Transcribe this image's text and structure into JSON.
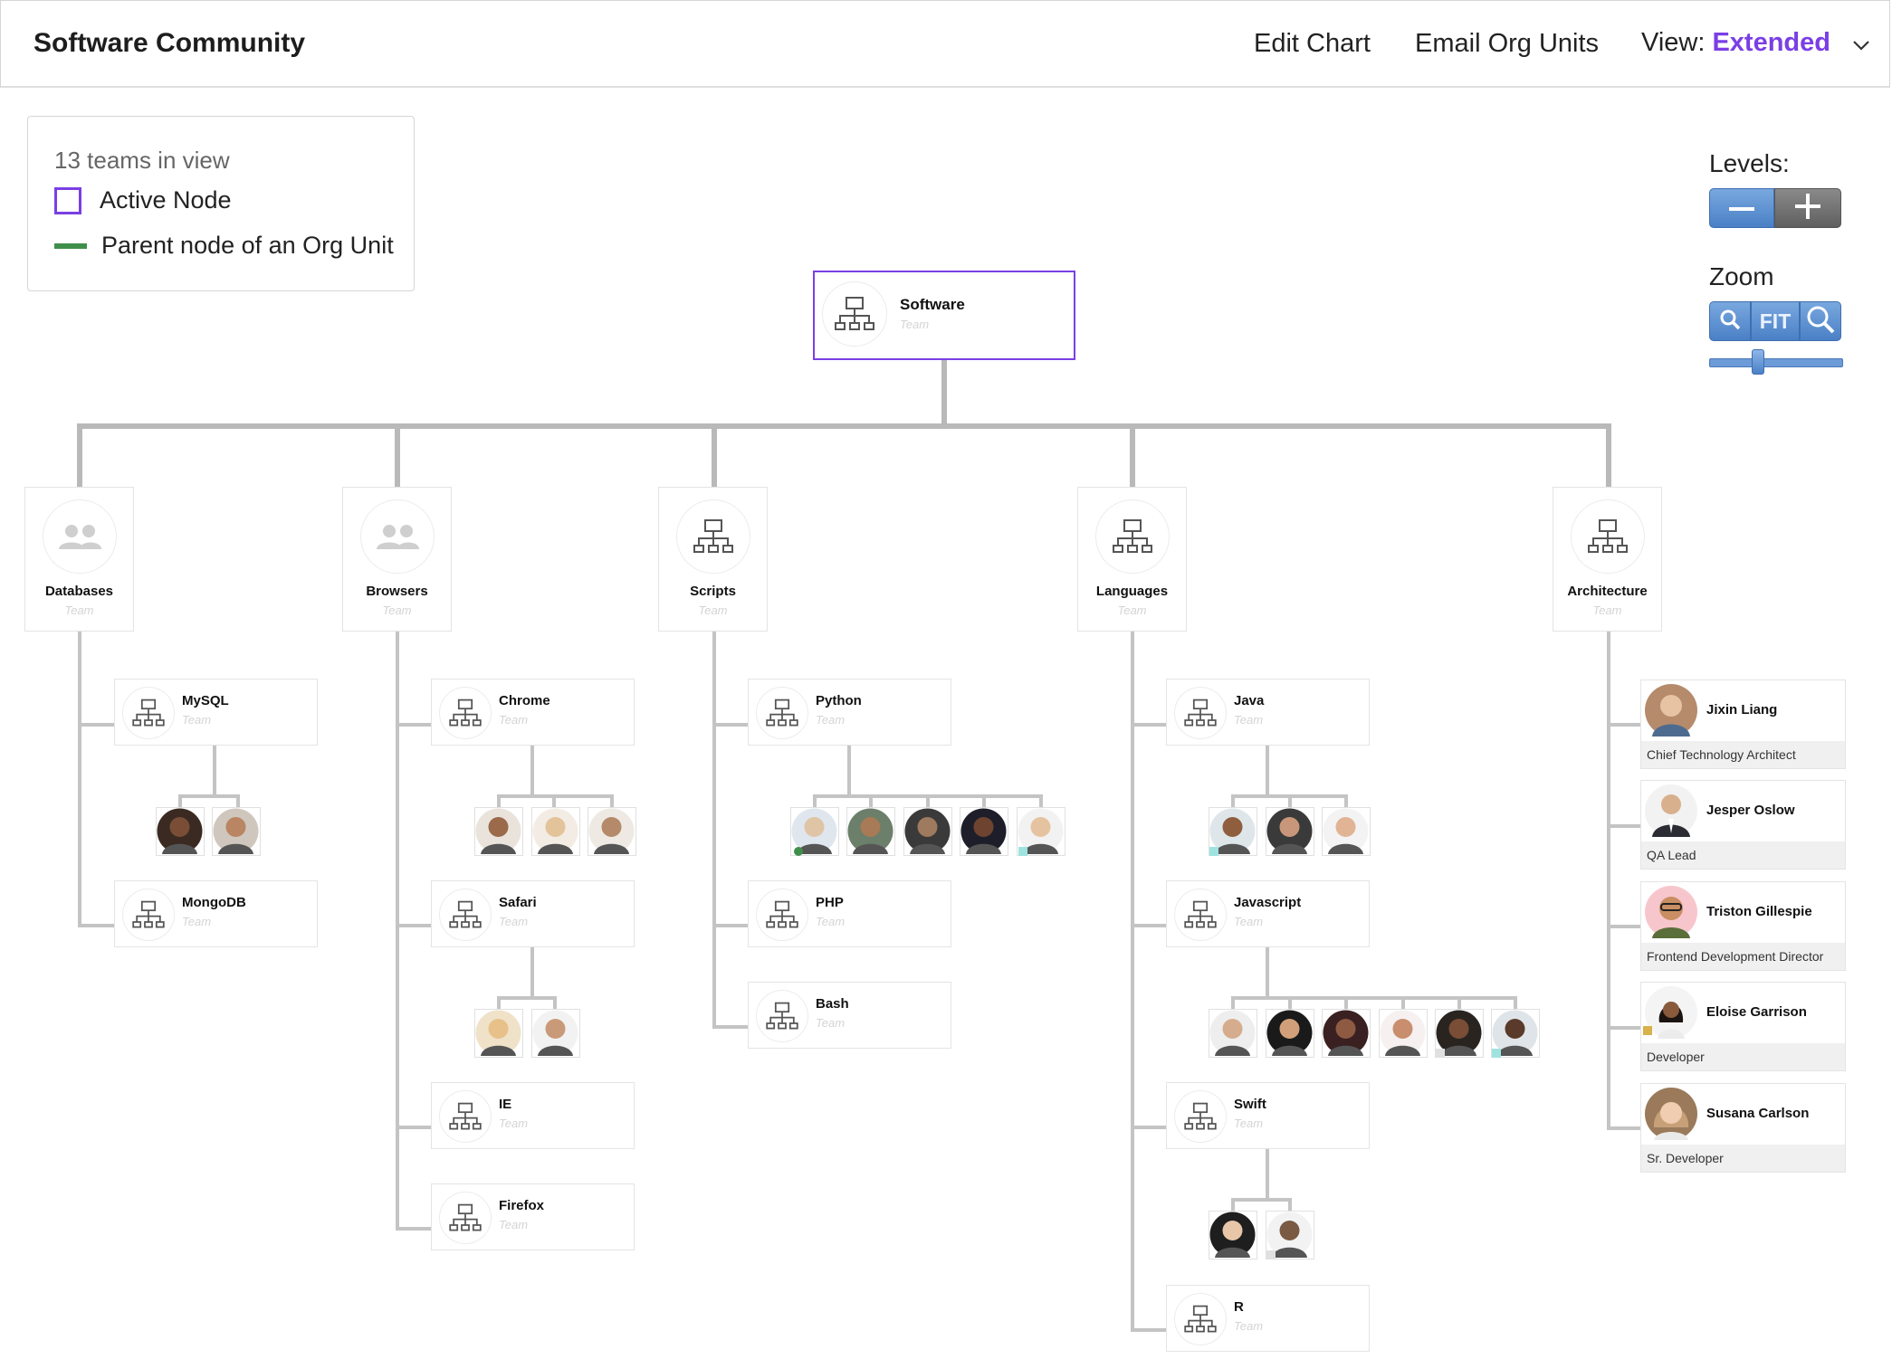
{
  "header": {
    "title": "Software Community",
    "edit_chart": "Edit Chart",
    "email_org_units": "Email Org Units",
    "view_label": "View:",
    "view_value": "Extended"
  },
  "legend": {
    "count": "13 teams in view",
    "active_node": "Active Node",
    "parent_node": "Parent node of an Org Unit"
  },
  "controls": {
    "levels_label": "Levels:",
    "zoom_label": "Zoom",
    "fit_label": "FIT",
    "zoom_level": 0.4
  },
  "colors": {
    "active_node": "#7a3fe4",
    "parent_node": "#3f8f4a",
    "connector": "#b9b9b9",
    "control_blue": "#5a8fd2"
  },
  "root": {
    "name": "Software",
    "type": "Team"
  },
  "groups": [
    {
      "name": "Databases",
      "type": "Team",
      "icon": "people-icon"
    },
    {
      "name": "Browsers",
      "type": "Team",
      "icon": "people-icon"
    },
    {
      "name": "Scripts",
      "type": "Team",
      "icon": "org-chart-icon"
    },
    {
      "name": "Languages",
      "type": "Team",
      "icon": "org-chart-icon"
    },
    {
      "name": "Architecture",
      "type": "Team",
      "icon": "org-chart-icon"
    }
  ],
  "teams": {
    "databases": [
      {
        "name": "MySQL",
        "type": "Team"
      },
      {
        "name": "MongoDB",
        "type": "Team"
      }
    ],
    "browsers": [
      {
        "name": "Chrome",
        "type": "Team"
      },
      {
        "name": "Safari",
        "type": "Team"
      },
      {
        "name": "IE",
        "type": "Team"
      },
      {
        "name": "Firefox",
        "type": "Team"
      }
    ],
    "scripts": [
      {
        "name": "Python",
        "type": "Team"
      },
      {
        "name": "PHP",
        "type": "Team"
      },
      {
        "name": "Bash",
        "type": "Team"
      }
    ],
    "languages": [
      {
        "name": "Java",
        "type": "Team"
      },
      {
        "name": "Javascript",
        "type": "Team"
      },
      {
        "name": "Swift",
        "type": "Team"
      },
      {
        "name": "R",
        "type": "Team"
      }
    ]
  },
  "architecture_people": [
    {
      "name": "Jixin Liang",
      "role": "Chief Technology Architect"
    },
    {
      "name": "Jesper Oslow",
      "role": "QA Lead"
    },
    {
      "name": "Triston Gillespie",
      "role": "Frontend Development Director"
    },
    {
      "name": "Eloise Garrison",
      "role": "Developer"
    },
    {
      "name": "Susana Carlson",
      "role": "Sr. Developer"
    }
  ]
}
